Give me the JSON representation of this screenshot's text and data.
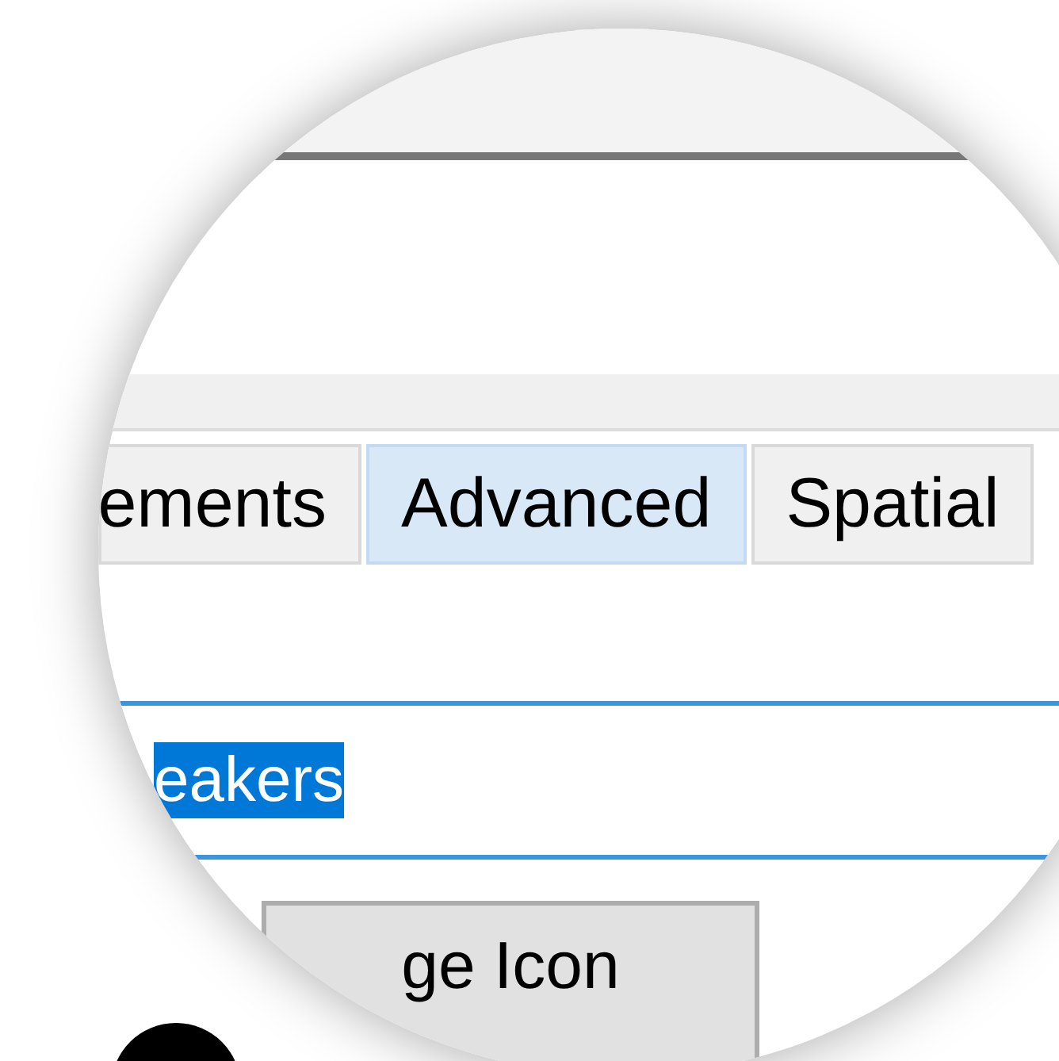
{
  "tabs": [
    {
      "label": "ements",
      "selected": false
    },
    {
      "label": "Advanced",
      "selected": true
    },
    {
      "label": "Spatial",
      "selected": false
    }
  ],
  "name_field": {
    "value": "eakers",
    "text_selected": true
  },
  "button": {
    "label": "ge Icon"
  }
}
